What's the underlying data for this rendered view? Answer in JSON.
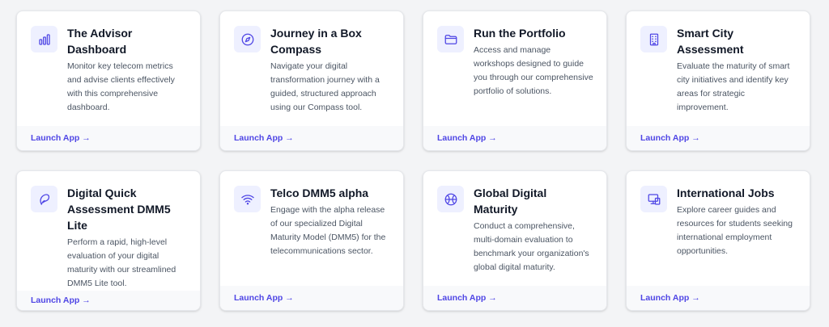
{
  "cards": [
    {
      "title": "The Advisor Dashboard",
      "description": "Monitor key telecom metrics and advise clients effectively with this comprehensive dashboard.",
      "icon": "bar-chart-icon",
      "link": "Launch App →"
    },
    {
      "title": "Journey in a Box Compass",
      "description": "Navigate your digital transformation journey with a guided, structured approach using our Compass tool.",
      "icon": "compass-icon",
      "link": "Launch App →"
    },
    {
      "title": "Run the Portfolio",
      "description": "Access and manage workshops designed to guide you through our comprehensive portfolio of solutions.",
      "icon": "folder-icon",
      "link": "Launch App →"
    },
    {
      "title": "Smart City Assessment",
      "description": "Evaluate the maturity of smart city initiatives and identify key areas for strategic improvement.",
      "icon": "building-icon",
      "link": "Launch App →"
    },
    {
      "title": "Digital Quick Assessment DMM5 Lite",
      "description": "Perform a rapid, high-level evaluation of your digital maturity with our streamlined DMM5 Lite tool.",
      "icon": "leaf-icon",
      "link": "Launch App →"
    },
    {
      "title": "Telco DMM5 alpha",
      "description": "Engage with the alpha release of our specialized Digital Maturity Model (DMM5) for the telecommunications sector.",
      "icon": "wifi-icon",
      "link": "Launch App →"
    },
    {
      "title": "Global Digital Maturity",
      "description": "Conduct a comprehensive, multi-domain evaluation to benchmark your organization's global digital maturity.",
      "icon": "globe-icon",
      "link": "Launch App →"
    },
    {
      "title": "International Jobs",
      "description": "Explore career guides and resources for students seeking international employment opportunities.",
      "icon": "monitor-icon",
      "link": "Launch App →"
    }
  ],
  "colors": {
    "accent": "#4f46e5",
    "icon_bg": "#eef0ff",
    "title": "#111827",
    "text": "#4b5563",
    "footer_bg": "#f8f9fb"
  }
}
